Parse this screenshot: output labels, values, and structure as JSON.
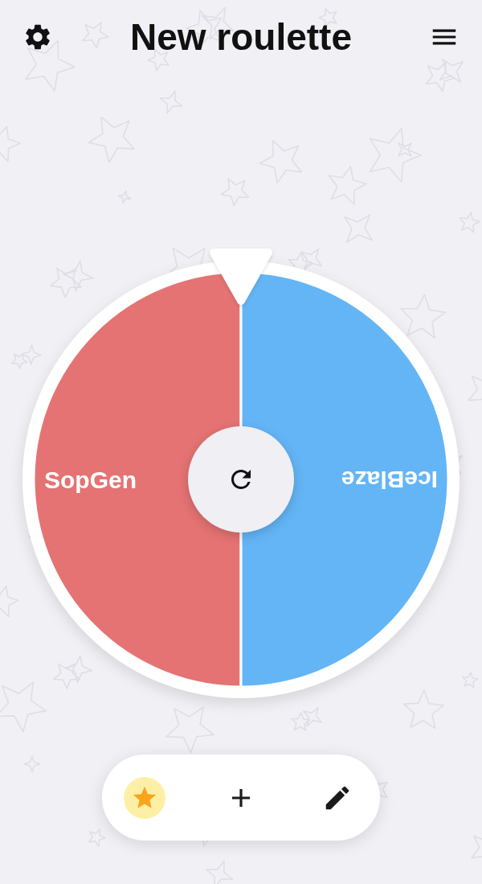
{
  "header": {
    "title": "New roulette"
  },
  "wheel": {
    "segments": [
      {
        "label": "SopGen",
        "color": "#e57373"
      },
      {
        "label": "IceBlaze",
        "color": "#64b5f6"
      }
    ]
  },
  "toolbar": {
    "buttons": [
      {
        "kind": "favorite",
        "on": true
      },
      {
        "kind": "add",
        "on": false
      },
      {
        "kind": "edit",
        "on": false
      }
    ]
  }
}
